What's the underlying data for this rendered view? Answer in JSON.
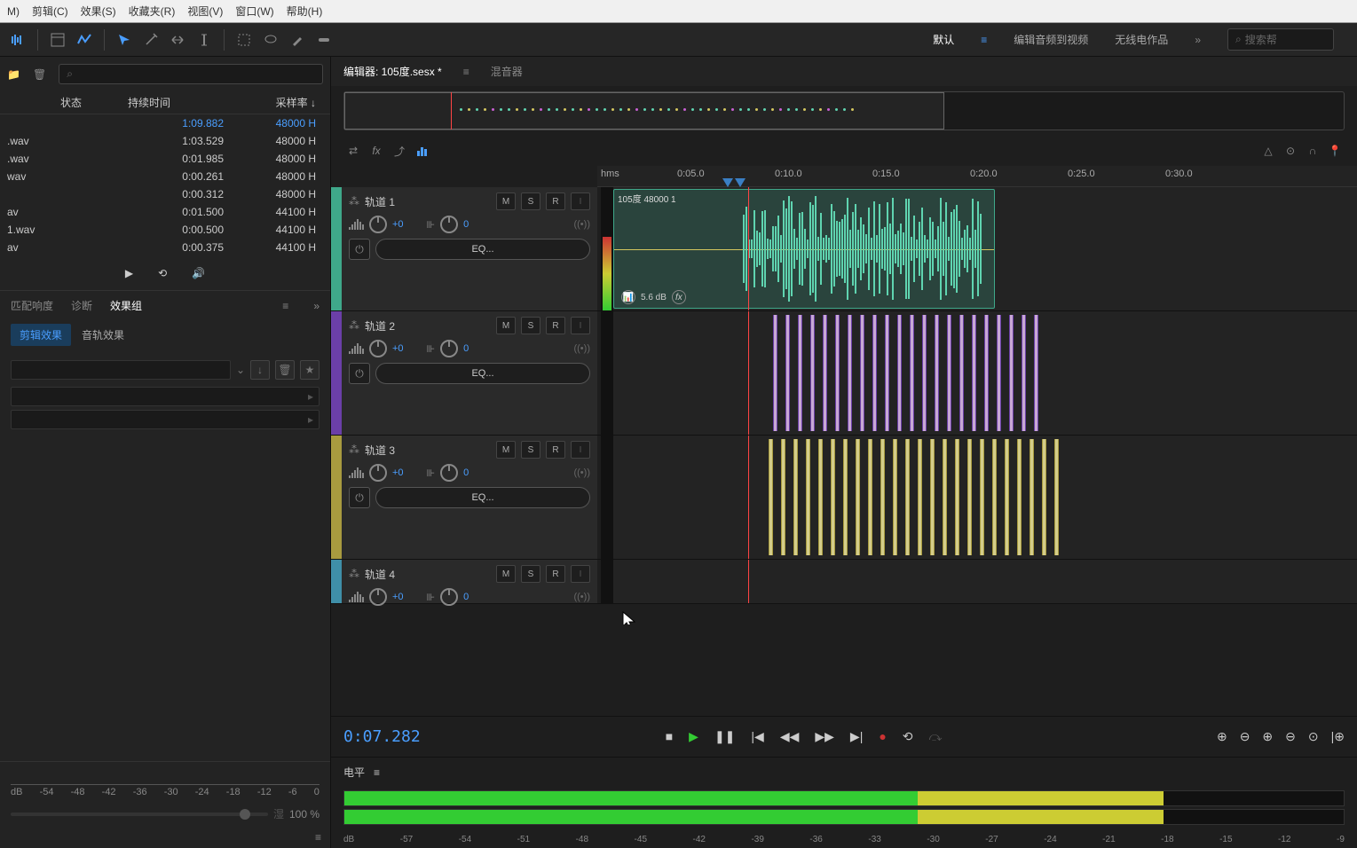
{
  "menu": [
    "M)",
    "剪辑(C)",
    "效果(S)",
    "收藏夹(R)",
    "视图(V)",
    "窗口(W)",
    "帮助(H)"
  ],
  "workspaces": {
    "default": "默认",
    "edit_audio": "编辑音频到视频",
    "radio": "无线电作品"
  },
  "search_placeholder": "搜索帮",
  "files": {
    "columns": {
      "status": "状态",
      "duration": "持续时间",
      "rate": "采样率"
    },
    "rows": [
      {
        "name": "",
        "duration": "1:09.882",
        "rate": "48000 H",
        "selected": true
      },
      {
        "name": ".wav",
        "duration": "1:03.529",
        "rate": "48000 H"
      },
      {
        "name": ".wav",
        "duration": "0:01.985",
        "rate": "48000 H"
      },
      {
        "name": "wav",
        "duration": "0:00.261",
        "rate": "48000 H"
      },
      {
        "name": "",
        "duration": "0:00.312",
        "rate": "48000 H"
      },
      {
        "name": "av",
        "duration": "0:01.500",
        "rate": "44100 H"
      },
      {
        "name": "1.wav",
        "duration": "0:00.500",
        "rate": "44100 H"
      },
      {
        "name": "av",
        "duration": "0:00.375",
        "rate": "44100 H"
      }
    ]
  },
  "effects": {
    "tabs": {
      "match": "匹配响度",
      "diag": "诊断",
      "group": "效果组"
    },
    "sub": {
      "clip": "剪辑效果",
      "track": "音轨效果"
    }
  },
  "db_labels": [
    "dB",
    "-54",
    "-48",
    "-42",
    "-36",
    "-30",
    "-24",
    "-18",
    "-12",
    "-6",
    "0"
  ],
  "wet": {
    "label": "湿",
    "value": "100 %"
  },
  "editor": {
    "tabs": {
      "editor": "编辑器: 105度.sesx *",
      "mixer": "混音器"
    }
  },
  "ruler": [
    "hms",
    "0:05.0",
    "0:10.0",
    "0:15.0",
    "0:20.0",
    "0:25.0",
    "0:30.0"
  ],
  "tracks": [
    {
      "name": "轨道 1",
      "color": "#3fa88a",
      "vol": "+0",
      "pan": "0",
      "eq": "EQ...",
      "clip_label": "105度 48000 1",
      "gain": "5.6 dB"
    },
    {
      "name": "轨道 2",
      "color": "#6b3fa8",
      "vol": "+0",
      "pan": "0",
      "eq": "EQ..."
    },
    {
      "name": "轨道 3",
      "color": "#a89b3f",
      "vol": "+0",
      "pan": "0",
      "eq": "EQ..."
    },
    {
      "name": "轨道 4",
      "color": "#3f8fa8",
      "vol": "+0",
      "pan": "0",
      "eq": "EQ..."
    }
  ],
  "timecode": "0:07.282",
  "level": {
    "title": "电平",
    "scale": [
      "dB",
      "-57",
      "-54",
      "-51",
      "-48",
      "-45",
      "-42",
      "-39",
      "-36",
      "-33",
      "-30",
      "-27",
      "-24",
      "-21",
      "-18",
      "-15",
      "-12",
      "-9"
    ]
  }
}
